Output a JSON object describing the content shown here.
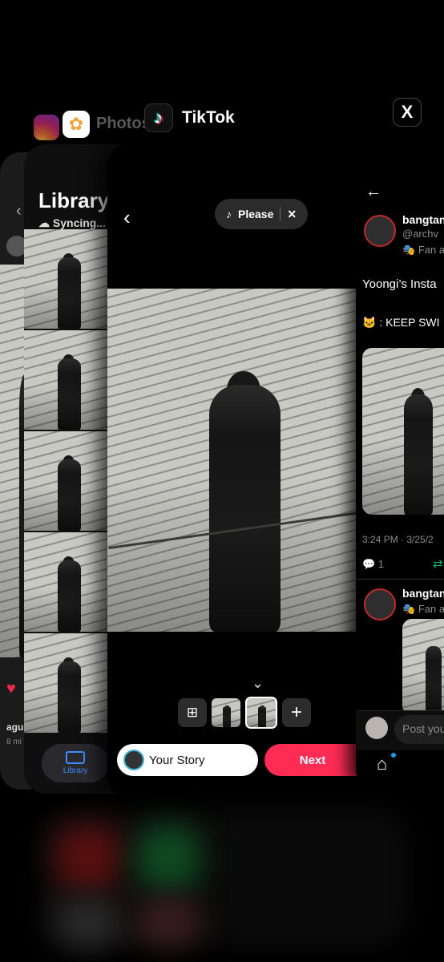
{
  "switcher": {
    "photos_app_name": "Photos",
    "tiktok_app_name": "TikTok",
    "x_app_glyph": "X"
  },
  "photos_card": {
    "title": "Library",
    "sync_status": "Syncing...",
    "tab_label": "Library"
  },
  "instagram_card": {
    "username": "agu",
    "time": "8 mi"
  },
  "tiktok_card": {
    "music_label": "Please",
    "story_button": "Your Story",
    "next_button": "Next",
    "close_glyph": "✕",
    "back_glyph": "‹",
    "add_glyph": "+"
  },
  "x_card": {
    "author_name": "bangtan",
    "author_handle": "@archv",
    "author_badge": "Fan a",
    "tweet_text_1": "Yoongi’s Insta",
    "tweet_text_2": ": KEEP SWI",
    "timestamp": "3:24 PM · 3/25/2",
    "reply_count": "1",
    "second_author_name": "bangtan",
    "second_author_badge": "Fan a",
    "reply_placeholder": "Post you"
  },
  "colors": {
    "tiktok_red": "#fe2c55",
    "story_ring": "#3eb2d2",
    "x_blue": "#1d9bf0",
    "retweet_green": "#00ba7c",
    "photos_blue": "#3d8cff"
  }
}
